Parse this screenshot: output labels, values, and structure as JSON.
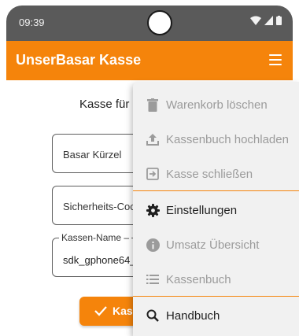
{
  "status_bar": {
    "time": "09:39"
  },
  "app_bar": {
    "title": "UnserBasar Kasse"
  },
  "content": {
    "heading_partial": "Kasse für U",
    "field_basar_kuerzel_placeholder": "Basar Kürzel",
    "field_sicherheitscode_placeholder": "Sicherheits-Coc",
    "field_kassenname_label": "Kassen-Name –",
    "field_kassenname_value": "sdk_gphone64_",
    "submit_label": "Kas"
  },
  "menu": {
    "items": [
      {
        "label": "Warenkorb löschen",
        "icon": "trash-icon",
        "enabled": false
      },
      {
        "label": "Kassenbuch hochladen",
        "icon": "upload-icon",
        "enabled": false
      },
      {
        "label": "Kasse schließen",
        "icon": "exit-icon",
        "enabled": false
      },
      {
        "label": "Einstellungen",
        "icon": "gear-icon",
        "enabled": true
      },
      {
        "label": "Umsatz Übersicht",
        "icon": "info-icon",
        "enabled": false
      },
      {
        "label": "Kassenbuch",
        "icon": "list-icon",
        "enabled": false
      },
      {
        "label": "Handbuch",
        "icon": "search-icon",
        "enabled": true
      }
    ]
  },
  "colors": {
    "accent": "#f5840b",
    "status_bar": "#5a5a5a",
    "menu_bg": "#f1f1f1",
    "disabled_text": "#9b9b9b"
  }
}
